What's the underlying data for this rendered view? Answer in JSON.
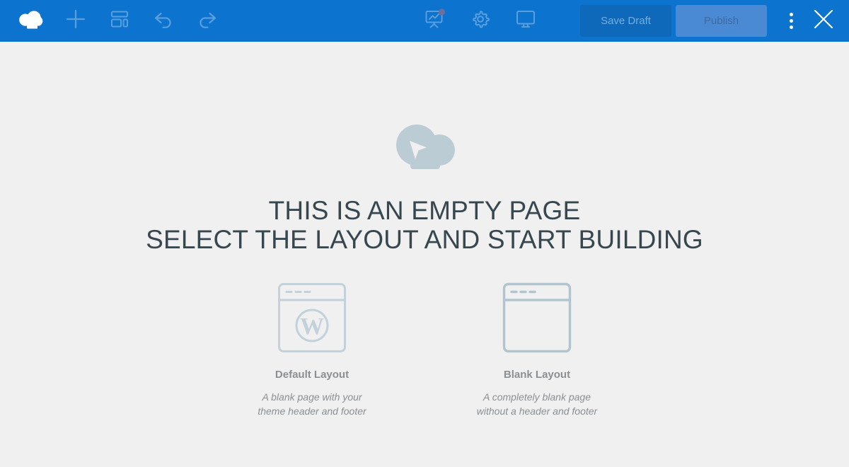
{
  "toolbar": {
    "logo": {
      "name": "cloud-logo"
    },
    "left_items": [
      {
        "name": "add-icon",
        "label": "Add"
      },
      {
        "name": "layout-icon",
        "label": "Layout"
      },
      {
        "name": "undo-icon",
        "label": "Undo"
      },
      {
        "name": "redo-icon",
        "label": "Redo"
      }
    ],
    "center_items": [
      {
        "name": "presentation-chart-icon",
        "label": "Stats",
        "badge": true
      },
      {
        "name": "gear-icon",
        "label": "Settings",
        "badge": false
      },
      {
        "name": "desktop-icon",
        "label": "Responsive",
        "badge": false
      }
    ],
    "save_draft_label": "Save Draft",
    "publish_label": "Publish",
    "more_options_label": "More options",
    "close_label": "Close",
    "colors": {
      "bar": "#0c73cf",
      "save_draft_bg": "#0f69ba",
      "save_draft_text": "#74aee2",
      "publish_bg": "#4a8ad4",
      "publish_text": "#40699f",
      "icon": "#5a9fdd",
      "badge": "#6b6f9e"
    }
  },
  "canvas": {
    "background": "#f0f0f0",
    "empty_state": {
      "mark_name": "cloud-cursor-mark",
      "mark_color": "#bcccd4",
      "heading_line1": "THIS IS AN EMPTY PAGE",
      "heading_line2": "SELECT THE LAYOUT AND START BUILDING",
      "heading_color": "#37474f"
    },
    "layout_choices": [
      {
        "key": "default",
        "title": "Default Layout",
        "description_line1": "A blank page with your",
        "description_line2": "theme header and footer",
        "art_name": "browser-window-wordpress-icon",
        "art_color": "#c3d2da",
        "selected": false
      },
      {
        "key": "blank",
        "title": "Blank Layout",
        "description_line1": "A completely blank page",
        "description_line2": "without a header and footer",
        "art_name": "browser-window-blank-icon",
        "art_color": "#b2c4ce",
        "selected": true
      }
    ]
  }
}
